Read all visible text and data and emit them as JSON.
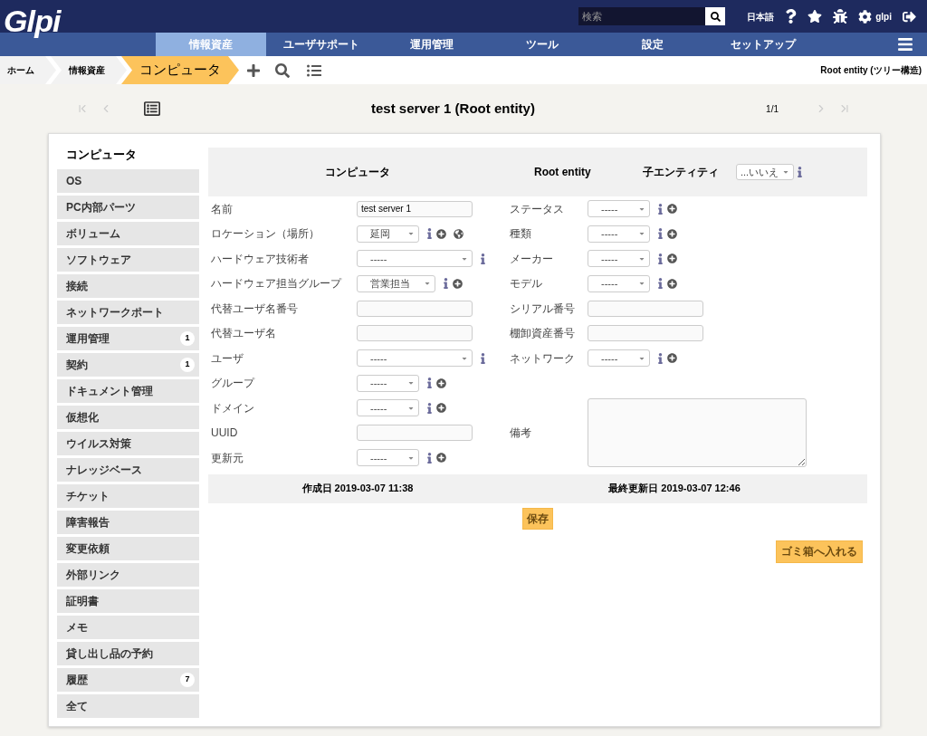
{
  "header": {
    "logo": "Glpi",
    "search": {
      "placeholder": "検索"
    },
    "language": "日本語",
    "user": "glpi"
  },
  "menu": [
    {
      "label": "情報資産",
      "selected": true
    },
    {
      "label": "ユーザサポート",
      "selected": false
    },
    {
      "label": "運用管理",
      "selected": false
    },
    {
      "label": "ツール",
      "selected": false
    },
    {
      "label": "設定",
      "selected": false
    },
    {
      "label": "セットアップ",
      "selected": false
    }
  ],
  "breadcrumbs": [
    {
      "label": "ホーム",
      "selected": false
    },
    {
      "label": "情報資産",
      "selected": false
    },
    {
      "label": "コンピュータ",
      "selected": true
    }
  ],
  "entity": "Root entity (ツリー構造)",
  "title": "test server 1 (Root entity)",
  "pager": "1/1",
  "tabs": [
    {
      "label": "コンピュータ",
      "selected": true
    },
    {
      "label": "OS",
      "selected": false
    },
    {
      "label": "PC内部パーツ",
      "selected": false
    },
    {
      "label": "ボリューム",
      "selected": false
    },
    {
      "label": "ソフトウェア",
      "selected": false
    },
    {
      "label": "接続",
      "selected": false
    },
    {
      "label": "ネットワークポート",
      "selected": false
    },
    {
      "label": "運用管理",
      "selected": false,
      "badge": "1"
    },
    {
      "label": "契約",
      "selected": false,
      "badge": "1"
    },
    {
      "label": "ドキュメント管理",
      "selected": false
    },
    {
      "label": "仮想化",
      "selected": false
    },
    {
      "label": "ウイルス対策",
      "selected": false
    },
    {
      "label": "ナレッジベース",
      "selected": false
    },
    {
      "label": "チケット",
      "selected": false
    },
    {
      "label": "障害報告",
      "selected": false
    },
    {
      "label": "変更依頼",
      "selected": false
    },
    {
      "label": "外部リンク",
      "selected": false
    },
    {
      "label": "証明書",
      "selected": false
    },
    {
      "label": "メモ",
      "selected": false
    },
    {
      "label": "貸し出し品の予約",
      "selected": false
    },
    {
      "label": "履歴",
      "selected": false,
      "badge": "7"
    },
    {
      "label": "全て",
      "selected": false
    }
  ],
  "form_header": {
    "type": "コンピュータ",
    "entity": "Root entity",
    "recursive_label": "子エンティティ",
    "recursive_value": "...いいえ"
  },
  "left_fields": [
    {
      "label": "名前",
      "kind": "text",
      "value": "test server 1"
    },
    {
      "label": "ロケーション（場所）",
      "kind": "select",
      "value": "延岡",
      "info": true,
      "add": true,
      "globe": true
    },
    {
      "label": "ハードウェア技術者",
      "kind": "select_wide",
      "value": "-----",
      "info": true
    },
    {
      "label": "ハードウェア担当グループ",
      "kind": "select_mid",
      "value": "営業担当",
      "info": true,
      "add": true
    },
    {
      "label": "代替ユーザ名番号",
      "kind": "text"
    },
    {
      "label": "代替ユーザ名",
      "kind": "text"
    },
    {
      "label": "ユーザ",
      "kind": "select_wide",
      "value": "-----",
      "info": true
    },
    {
      "label": "グループ",
      "kind": "select",
      "value": "-----",
      "info": true,
      "add": true
    },
    {
      "label": "ドメイン",
      "kind": "select",
      "value": "-----",
      "info": true,
      "add": true
    },
    {
      "label": "UUID",
      "kind": "text"
    },
    {
      "label": "更新元",
      "kind": "select",
      "value": "-----",
      "info": true,
      "add": true
    }
  ],
  "right_fields": [
    {
      "label": "ステータス",
      "kind": "select",
      "value": "-----",
      "info": true,
      "add": true
    },
    {
      "label": "種類",
      "kind": "select",
      "value": "-----",
      "info": true,
      "add": true
    },
    {
      "label": "メーカー",
      "kind": "select",
      "value": "-----",
      "info": true,
      "add": true
    },
    {
      "label": "モデル",
      "kind": "select",
      "value": "-----",
      "info": true,
      "add": true
    },
    {
      "label": "シリアル番号",
      "kind": "text"
    },
    {
      "label": "棚卸資産番号",
      "kind": "text"
    },
    {
      "label": "ネットワーク",
      "kind": "select",
      "value": "-----",
      "info": true,
      "add": true
    },
    {
      "label": "備考",
      "kind": "textarea"
    }
  ],
  "footer": {
    "created": "作成日 2019-03-07 11:38",
    "updated": "最終更新日 2019-03-07 12:46"
  },
  "buttons": {
    "save": "保存",
    "trash": "ゴミ箱へ入れる"
  }
}
